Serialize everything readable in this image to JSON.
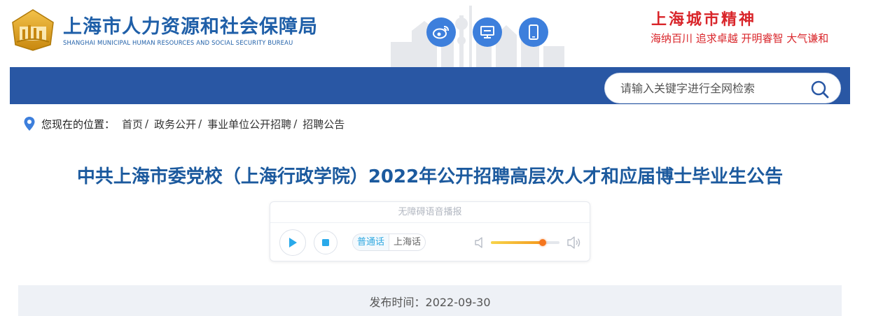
{
  "header": {
    "org_name_cn": "上海市人力资源和社会保障局",
    "org_name_en": "SHANGHAI MUNICIPAL HUMAN RESOURCES AND SOCIAL SECURITY BUREAU",
    "share_icons": [
      "weibo-icon",
      "desktop-icon",
      "mobile-icon"
    ],
    "spirit_title": "上海城市精神",
    "spirit_slogan": "海纳百川  追求卓越  开明睿智  大气谦和"
  },
  "search": {
    "placeholder": "请输入关键字进行全网检索",
    "value": ""
  },
  "breadcrumb": {
    "label": "您现在的位置：",
    "items": [
      "首页",
      "政务公开",
      "事业单位公开招聘",
      "招聘公告"
    ],
    "separator": "/"
  },
  "article": {
    "title": "中共上海市委党校（上海行政学院）2022年公开招聘高层次人才和应届博士毕业生公告",
    "publish_label": "发布时间：",
    "publish_date": "2022-09-30"
  },
  "player": {
    "header": "无障碍语音播报",
    "lang_options": [
      "普通话",
      "上海话"
    ],
    "selected_lang": "普通话",
    "volume": 0.76
  },
  "colors": {
    "nav_blue": "#2957a4",
    "title_blue": "#1c5a9e",
    "accent_red": "#d9252a",
    "icon_blue": "#3d7fdc"
  }
}
